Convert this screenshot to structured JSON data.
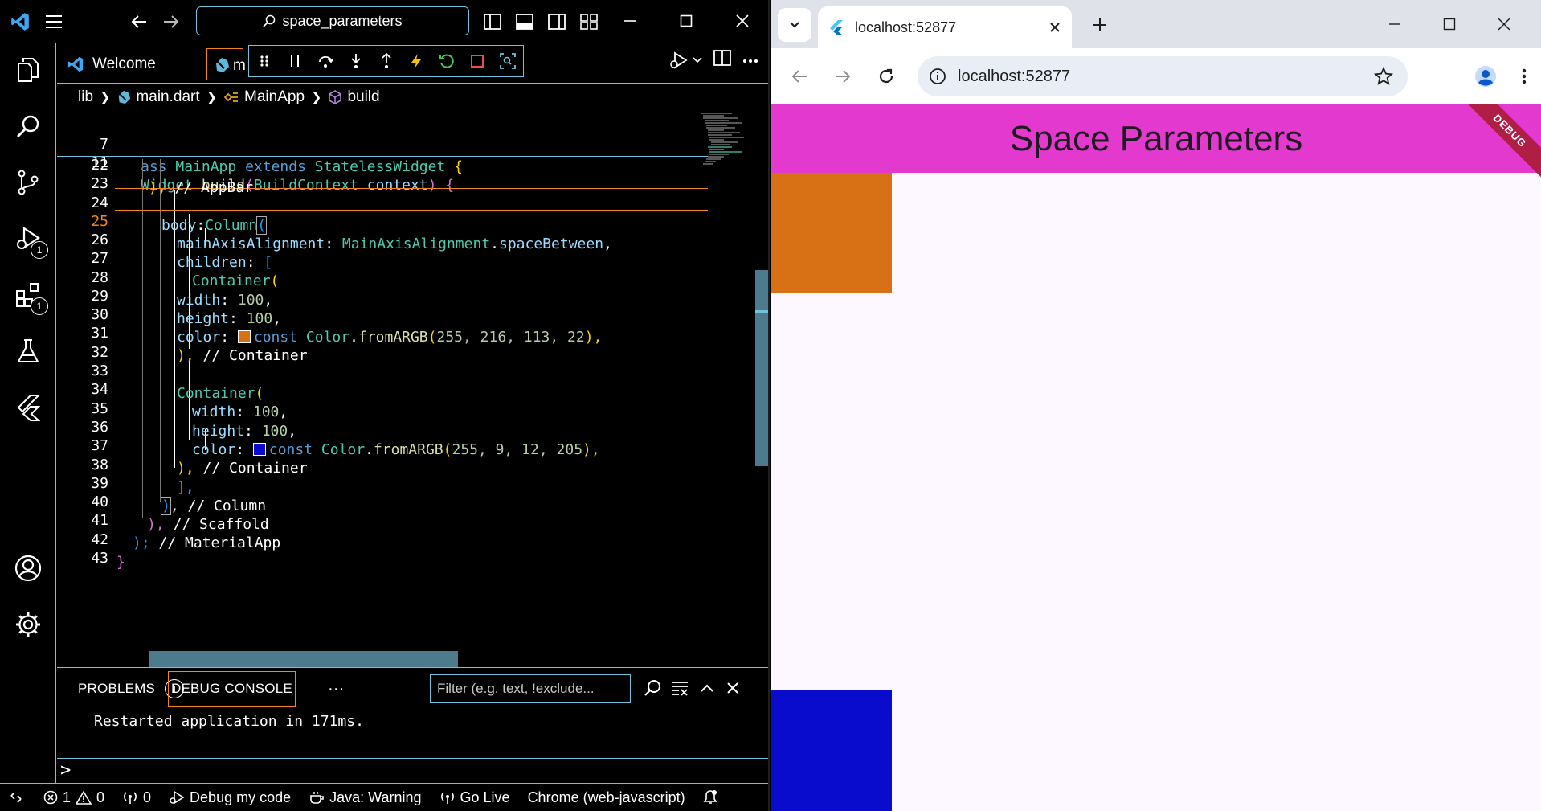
{
  "vscode": {
    "command_center": "space_parameters",
    "tabs": [
      {
        "label": "Welcome"
      },
      {
        "label": "m"
      }
    ],
    "breadcrumb": {
      "folder": "lib",
      "file": "main.dart",
      "class": "MainApp",
      "method": "build"
    },
    "sticky": [
      {
        "n": "7",
        "code": "ass MainApp extends StatelessWidget {"
      },
      {
        "n": "11",
        "code": "Widget build(BuildContext context) {"
      }
    ],
    "lines": [
      {
        "n": "22",
        "c1": "), ",
        "c2": "// AppBar"
      },
      {
        "n": "23"
      },
      {
        "n": "24",
        "c1": "body",
        "c2": ":",
        "c3": "Column",
        "c4": "("
      },
      {
        "n": "25",
        "c1": "mainAxisAlignment",
        "c2": ": ",
        "c3": "MainAxisAlignment",
        "c4": ".",
        "c5": "spaceBetween",
        "c6": ","
      },
      {
        "n": "26",
        "c1": "children",
        "c2": ": ",
        "c3": "["
      },
      {
        "n": "27",
        "c1": "Container",
        "c2": "("
      },
      {
        "n": "28",
        "c1": "width",
        "c2": ": ",
        "c3": "100",
        "c4": ","
      },
      {
        "n": "29",
        "c1": "height",
        "c2": ": ",
        "c3": "100",
        "c4": ","
      },
      {
        "n": "30",
        "c1": "color",
        "c2": ": ",
        "kw": "const",
        "ty": "Color",
        "fn": "fromARGB",
        "args": "255, 216, 113, 22",
        "end": "),"
      },
      {
        "n": "31",
        "c1": "), ",
        "c2": "// Container"
      },
      {
        "n": "32"
      },
      {
        "n": "33",
        "c1": "Container",
        "c2": "("
      },
      {
        "n": "34",
        "c1": "width",
        "c2": ": ",
        "c3": "100",
        "c4": ","
      },
      {
        "n": "35",
        "c1": "height",
        "c2": ": ",
        "c3": "100",
        "c4": ","
      },
      {
        "n": "36",
        "c1": "color",
        "c2": ": ",
        "kw": "const",
        "ty": "Color",
        "fn": "fromARGB",
        "args": "255, 9, 12, 205",
        "end": "),"
      },
      {
        "n": "37",
        "c1": "), ",
        "c2": "// Container"
      },
      {
        "n": "38",
        "c1": "],"
      },
      {
        "n": "39",
        "c1": ")",
        "c2": ", ",
        "c3": "// Column"
      },
      {
        "n": "40",
        "c1": "), ",
        "c2": "// Scaffold"
      },
      {
        "n": "41",
        "c1": "); ",
        "c2": "// MaterialApp"
      },
      {
        "n": "42",
        "c1": "}"
      },
      {
        "n": "43"
      }
    ],
    "panel": {
      "problems_label": "PROBLEMS",
      "problems_count": "1",
      "debug_console_label": "DEBUG CONSOLE",
      "more": "···",
      "filter_placeholder": "Filter (e.g. text, !exclude...",
      "output": "Restarted application in 171ms.",
      "prompt": ">"
    },
    "activity_badges": {
      "run": "1",
      "extensions": "1"
    },
    "status": {
      "errors": "1",
      "warnings": "0",
      "ports": "0",
      "debug": "Debug my code",
      "java": "Java: Warning",
      "golive": "Go Live",
      "device": "Chrome (web-javascript)"
    },
    "colors": {
      "accent_border": "#6fc3df",
      "active_border": "#f38518",
      "swatch_orange": "#d87116",
      "swatch_blue": "#090ccd"
    }
  },
  "chrome": {
    "tab_title": "localhost:52877",
    "url": "localhost:52877",
    "app": {
      "title": "Space Parameters",
      "debug_banner": "DEBUG",
      "appbar_color": "#e339ce",
      "box1_color": "#d87116",
      "box2_color": "#090ccd"
    }
  }
}
